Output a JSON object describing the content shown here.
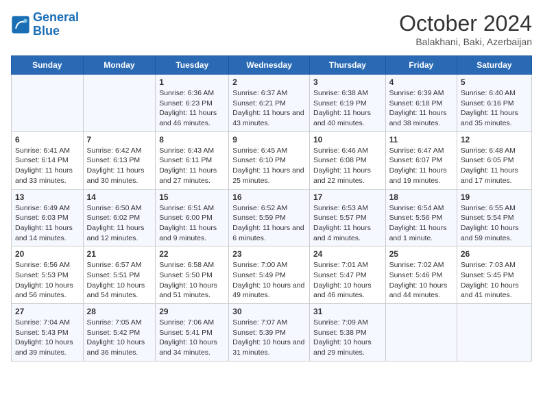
{
  "logo": {
    "line1": "General",
    "line2": "Blue"
  },
  "title": "October 2024",
  "subtitle": "Balakhani, Baki, Azerbaijan",
  "days_of_week": [
    "Sunday",
    "Monday",
    "Tuesday",
    "Wednesday",
    "Thursday",
    "Friday",
    "Saturday"
  ],
  "weeks": [
    [
      {
        "day": null
      },
      {
        "day": null
      },
      {
        "day": "1",
        "sunrise": "Sunrise: 6:36 AM",
        "sunset": "Sunset: 6:23 PM",
        "daylight": "Daylight: 11 hours and 46 minutes."
      },
      {
        "day": "2",
        "sunrise": "Sunrise: 6:37 AM",
        "sunset": "Sunset: 6:21 PM",
        "daylight": "Daylight: 11 hours and 43 minutes."
      },
      {
        "day": "3",
        "sunrise": "Sunrise: 6:38 AM",
        "sunset": "Sunset: 6:19 PM",
        "daylight": "Daylight: 11 hours and 40 minutes."
      },
      {
        "day": "4",
        "sunrise": "Sunrise: 6:39 AM",
        "sunset": "Sunset: 6:18 PM",
        "daylight": "Daylight: 11 hours and 38 minutes."
      },
      {
        "day": "5",
        "sunrise": "Sunrise: 6:40 AM",
        "sunset": "Sunset: 6:16 PM",
        "daylight": "Daylight: 11 hours and 35 minutes."
      }
    ],
    [
      {
        "day": "6",
        "sunrise": "Sunrise: 6:41 AM",
        "sunset": "Sunset: 6:14 PM",
        "daylight": "Daylight: 11 hours and 33 minutes."
      },
      {
        "day": "7",
        "sunrise": "Sunrise: 6:42 AM",
        "sunset": "Sunset: 6:13 PM",
        "daylight": "Daylight: 11 hours and 30 minutes."
      },
      {
        "day": "8",
        "sunrise": "Sunrise: 6:43 AM",
        "sunset": "Sunset: 6:11 PM",
        "daylight": "Daylight: 11 hours and 27 minutes."
      },
      {
        "day": "9",
        "sunrise": "Sunrise: 6:45 AM",
        "sunset": "Sunset: 6:10 PM",
        "daylight": "Daylight: 11 hours and 25 minutes."
      },
      {
        "day": "10",
        "sunrise": "Sunrise: 6:46 AM",
        "sunset": "Sunset: 6:08 PM",
        "daylight": "Daylight: 11 hours and 22 minutes."
      },
      {
        "day": "11",
        "sunrise": "Sunrise: 6:47 AM",
        "sunset": "Sunset: 6:07 PM",
        "daylight": "Daylight: 11 hours and 19 minutes."
      },
      {
        "day": "12",
        "sunrise": "Sunrise: 6:48 AM",
        "sunset": "Sunset: 6:05 PM",
        "daylight": "Daylight: 11 hours and 17 minutes."
      }
    ],
    [
      {
        "day": "13",
        "sunrise": "Sunrise: 6:49 AM",
        "sunset": "Sunset: 6:03 PM",
        "daylight": "Daylight: 11 hours and 14 minutes."
      },
      {
        "day": "14",
        "sunrise": "Sunrise: 6:50 AM",
        "sunset": "Sunset: 6:02 PM",
        "daylight": "Daylight: 11 hours and 12 minutes."
      },
      {
        "day": "15",
        "sunrise": "Sunrise: 6:51 AM",
        "sunset": "Sunset: 6:00 PM",
        "daylight": "Daylight: 11 hours and 9 minutes."
      },
      {
        "day": "16",
        "sunrise": "Sunrise: 6:52 AM",
        "sunset": "Sunset: 5:59 PM",
        "daylight": "Daylight: 11 hours and 6 minutes."
      },
      {
        "day": "17",
        "sunrise": "Sunrise: 6:53 AM",
        "sunset": "Sunset: 5:57 PM",
        "daylight": "Daylight: 11 hours and 4 minutes."
      },
      {
        "day": "18",
        "sunrise": "Sunrise: 6:54 AM",
        "sunset": "Sunset: 5:56 PM",
        "daylight": "Daylight: 11 hours and 1 minute."
      },
      {
        "day": "19",
        "sunrise": "Sunrise: 6:55 AM",
        "sunset": "Sunset: 5:54 PM",
        "daylight": "Daylight: 10 hours and 59 minutes."
      }
    ],
    [
      {
        "day": "20",
        "sunrise": "Sunrise: 6:56 AM",
        "sunset": "Sunset: 5:53 PM",
        "daylight": "Daylight: 10 hours and 56 minutes."
      },
      {
        "day": "21",
        "sunrise": "Sunrise: 6:57 AM",
        "sunset": "Sunset: 5:51 PM",
        "daylight": "Daylight: 10 hours and 54 minutes."
      },
      {
        "day": "22",
        "sunrise": "Sunrise: 6:58 AM",
        "sunset": "Sunset: 5:50 PM",
        "daylight": "Daylight: 10 hours and 51 minutes."
      },
      {
        "day": "23",
        "sunrise": "Sunrise: 7:00 AM",
        "sunset": "Sunset: 5:49 PM",
        "daylight": "Daylight: 10 hours and 49 minutes."
      },
      {
        "day": "24",
        "sunrise": "Sunrise: 7:01 AM",
        "sunset": "Sunset: 5:47 PM",
        "daylight": "Daylight: 10 hours and 46 minutes."
      },
      {
        "day": "25",
        "sunrise": "Sunrise: 7:02 AM",
        "sunset": "Sunset: 5:46 PM",
        "daylight": "Daylight: 10 hours and 44 minutes."
      },
      {
        "day": "26",
        "sunrise": "Sunrise: 7:03 AM",
        "sunset": "Sunset: 5:45 PM",
        "daylight": "Daylight: 10 hours and 41 minutes."
      }
    ],
    [
      {
        "day": "27",
        "sunrise": "Sunrise: 7:04 AM",
        "sunset": "Sunset: 5:43 PM",
        "daylight": "Daylight: 10 hours and 39 minutes."
      },
      {
        "day": "28",
        "sunrise": "Sunrise: 7:05 AM",
        "sunset": "Sunset: 5:42 PM",
        "daylight": "Daylight: 10 hours and 36 minutes."
      },
      {
        "day": "29",
        "sunrise": "Sunrise: 7:06 AM",
        "sunset": "Sunset: 5:41 PM",
        "daylight": "Daylight: 10 hours and 34 minutes."
      },
      {
        "day": "30",
        "sunrise": "Sunrise: 7:07 AM",
        "sunset": "Sunset: 5:39 PM",
        "daylight": "Daylight: 10 hours and 31 minutes."
      },
      {
        "day": "31",
        "sunrise": "Sunrise: 7:09 AM",
        "sunset": "Sunset: 5:38 PM",
        "daylight": "Daylight: 10 hours and 29 minutes."
      },
      {
        "day": null
      },
      {
        "day": null
      }
    ]
  ]
}
